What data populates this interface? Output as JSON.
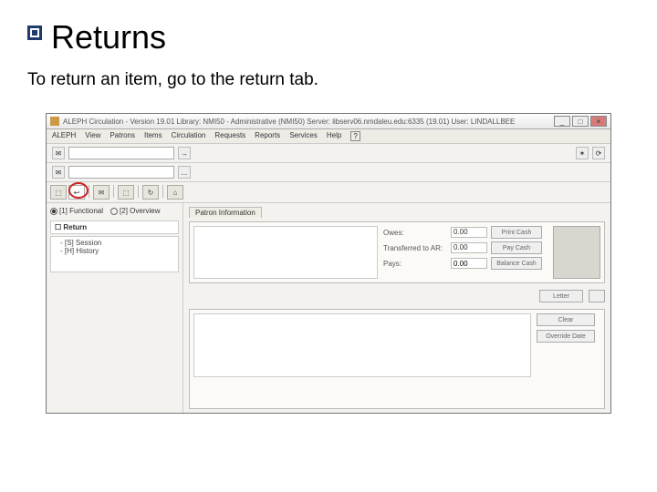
{
  "slide": {
    "title": "Returns",
    "subtitle": "To return an item, go to the return tab."
  },
  "window": {
    "title": "ALEPH Circulation - Version 19.01  Library: NMI50 - Administrative (NMI50)  Server: libserv06.nmdaleu.edu:6335 (19.01)  User: LINDALLBEE",
    "win_buttons": {
      "min": "_",
      "max": "□",
      "close": "×"
    }
  },
  "menubar": [
    "ALEPH",
    "View",
    "Patrons",
    "Items",
    "Circulation",
    "Requests",
    "Reports",
    "Services",
    "Help",
    "?"
  ],
  "toolbar": {
    "field1_value": "",
    "arrow_icon": "→",
    "field2_value": "",
    "dots": "...",
    "right_icons": [
      "✶",
      "⟳"
    ]
  },
  "tabs": {
    "items": [
      "⬚",
      "↩",
      "✉",
      "⬚",
      "↻",
      "⌂"
    ],
    "active_index": 1
  },
  "left_panel": {
    "radios": [
      {
        "label": "[1] Functional",
        "selected": true
      },
      {
        "label": "[2] Overview",
        "selected": false
      }
    ],
    "tree_header": "Return",
    "tree_items": [
      "[S] Session",
      "[H] History"
    ]
  },
  "patron": {
    "section_label": "Patron Information",
    "fields": {
      "owes_label": "Owes:",
      "owes_value": "0.00",
      "transferred_label": "Transferred to AR:",
      "transferred_value": "0.00",
      "pays_label": "Pays:",
      "pays_value": "0.00"
    },
    "buttons": {
      "print_cash": "Print Cash",
      "pay_cash": "Pay Cash",
      "balance_cash": "Balance Cash",
      "letter": "Letter"
    }
  },
  "lower": {
    "buttons": {
      "clear": "Clear",
      "override": "Override Date"
    }
  }
}
